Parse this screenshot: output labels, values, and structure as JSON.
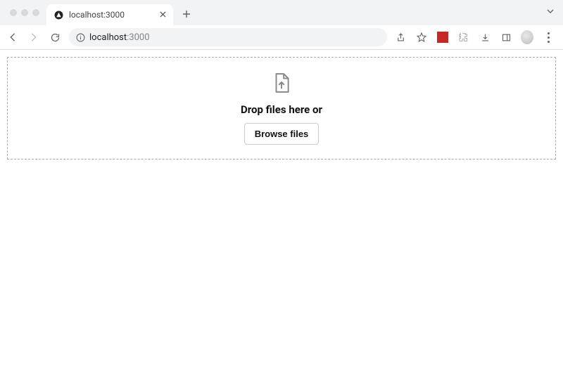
{
  "tab": {
    "title": "localhost:3000"
  },
  "address": {
    "host": "localhost",
    "port": ":3000"
  },
  "dropzone": {
    "label": "Drop files here or",
    "button": "Browse files"
  }
}
